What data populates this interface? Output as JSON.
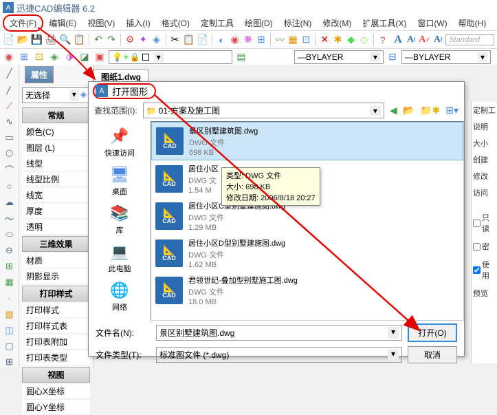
{
  "title": "迅捷CAD编辑器 6.2",
  "menu": {
    "file": "文件(F)",
    "edit": "编辑(E)",
    "view": "视图(V)",
    "insert": "插入(I)",
    "format": "格式(O)",
    "custom": "定制工具",
    "draw": "绘图(D)",
    "annotate": "标注(N)",
    "modify": "修改(M)",
    "ext": "扩展工具(X)",
    "window": "窗口(W)",
    "help": "帮助(H)"
  },
  "stylebox": "Standard",
  "layerbar": {
    "bylayer": "BYLAYER"
  },
  "drawtab": "图纸1.dwg",
  "prop": {
    "tab": "属性",
    "noselect": "无选择",
    "s_general": "常规",
    "color": "颜色(C)",
    "layer": "图层 (L)",
    "linetype": "线型",
    "ltscale": "线型比例",
    "lineweight": "线宽",
    "thickness": "厚度",
    "transparency": "透明",
    "s_3d": "三维效果",
    "material": "材质",
    "shadow": "阴影显示",
    "s_plot": "打印样式",
    "plotstyle": "打印样式",
    "plottable": "打印样式表",
    "plotattach": "打印表附加",
    "plottype": "打印表类型",
    "s_view": "视图",
    "centerx": "圆心X坐标",
    "centery": "圆心Y坐标"
  },
  "dialog": {
    "title": "打开图形",
    "lookin_label": "查找范围(I):",
    "lookin_value": "01-方案及施工图",
    "places": {
      "quick": "快速访问",
      "desktop": "桌面",
      "lib": "库",
      "pc": "此电脑",
      "net": "网络"
    },
    "files": [
      {
        "name": "景区别墅建筑图.dwg",
        "type": "DWG 文件",
        "size": "698 KB",
        "selected": true
      },
      {
        "name": "居住小区",
        "type": "DWG 文",
        "size": "1.54 M",
        "selected": false
      },
      {
        "name": "居住小区C型别墅建施图.dwg",
        "type": "DWG 文件",
        "size": "1.29 MB",
        "selected": false
      },
      {
        "name": "居住小区D型别墅建施图.dwg",
        "type": "DWG 文件",
        "size": "1.62 MB",
        "selected": false
      },
      {
        "name": "君领世纪-叠加型别墅施工图.dwg",
        "type": "DWG 文件",
        "size": "18.0 MB",
        "selected": false
      }
    ],
    "tooltip": {
      "type_label": "类型:",
      "type_value": "DWG 文件",
      "size_label": "大小:",
      "size_value": "698 KB",
      "date_label": "修改日期:",
      "date_value": "2006/8/18 20:27"
    },
    "filename_label": "文件名(N):",
    "filename_value": "景区别墅建筑图.dwg",
    "filetype_label": "文件类型(T):",
    "filetype_value": "标准图文件 (*.dwg)",
    "open": "打开(O)",
    "cancel": "取消"
  },
  "rpanel": {
    "custom": "定制工",
    "desc": "说明",
    "size": "大小",
    "create": "创建",
    "modify": "修改",
    "visit": "访问",
    "readonly": "只读",
    "dense": "密",
    "use": "使用",
    "preview": "预览"
  }
}
